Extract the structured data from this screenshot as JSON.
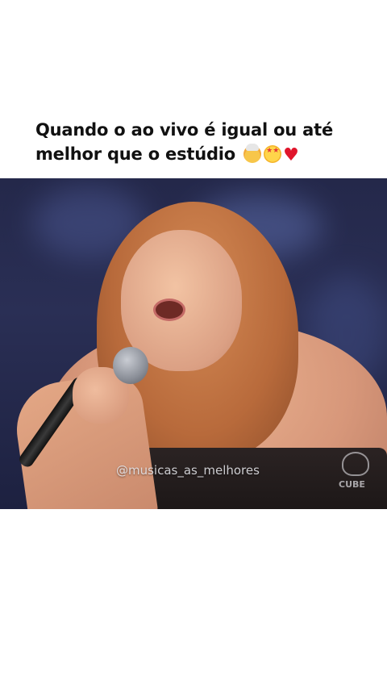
{
  "post": {
    "caption_line1": "Quando o ao vivo é igual ou até",
    "caption_line2": "melhor que o estúdio",
    "emojis": [
      "exploding-head-icon",
      "star-struck-icon",
      "red-heart-icon"
    ]
  },
  "video": {
    "watermark": "@musicas_as_melhores",
    "channel_logo_text": "CUBE"
  },
  "colors": {
    "background": "#ffffff",
    "caption_text": "#111111",
    "heart": "#e0152b"
  }
}
